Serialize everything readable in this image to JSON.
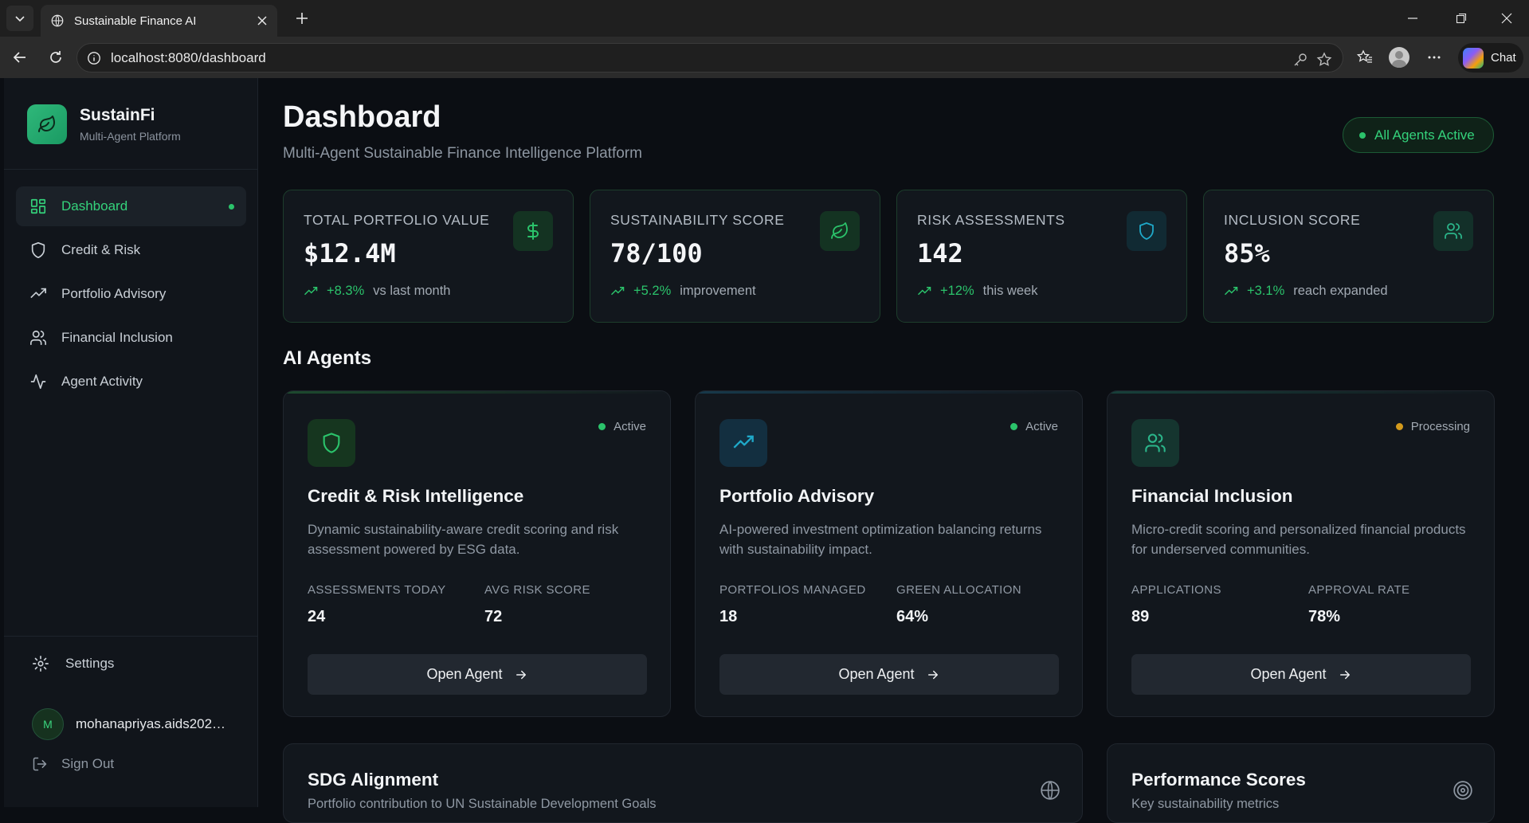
{
  "browser": {
    "tab_title": "Sustainable Finance AI",
    "url": "localhost:8080/dashboard",
    "chat_label": "Chat"
  },
  "sidebar": {
    "brand_name": "SustainFi",
    "brand_sub": "Multi-Agent Platform",
    "items": [
      {
        "label": "Dashboard",
        "icon": "layout-dashboard-icon",
        "active": true
      },
      {
        "label": "Credit & Risk",
        "icon": "shield-icon"
      },
      {
        "label": "Portfolio Advisory",
        "icon": "trending-up-icon"
      },
      {
        "label": "Financial Inclusion",
        "icon": "users-icon"
      },
      {
        "label": "Agent Activity",
        "icon": "activity-icon"
      }
    ],
    "settings_label": "Settings",
    "user_initial": "M",
    "user_name": "mohanapriyas.aids202…",
    "signout_label": "Sign Out"
  },
  "header": {
    "title": "Dashboard",
    "subtitle": "Multi-Agent Sustainable Finance Intelligence Platform",
    "status": "All Agents Active"
  },
  "stats": [
    {
      "label": "TOTAL PORTFOLIO VALUE",
      "value": "$12.4M",
      "change": "+8.3%",
      "note": "vs last month",
      "icon": "dollar-icon"
    },
    {
      "label": "SUSTAINABILITY SCORE",
      "value": "78/100",
      "change": "+5.2%",
      "note": "improvement",
      "icon": "leaf-icon"
    },
    {
      "label": "RISK ASSESSMENTS",
      "value": "142",
      "change": "+12%",
      "note": "this week",
      "icon": "shield-icon"
    },
    {
      "label": "INCLUSION SCORE",
      "value": "85%",
      "change": "+3.1%",
      "note": "reach expanded",
      "icon": "users-icon"
    }
  ],
  "agents_section_title": "AI Agents",
  "agents": [
    {
      "title": "Credit & Risk Intelligence",
      "status": "Active",
      "description": "Dynamic sustainability-aware credit scoring and risk assessment powered by ESG data.",
      "metrics": [
        {
          "label": "ASSESSMENTS TODAY",
          "value": "24"
        },
        {
          "label": "AVG RISK SCORE",
          "value": "72"
        }
      ],
      "button": "Open Agent"
    },
    {
      "title": "Portfolio Advisory",
      "status": "Active",
      "description": "AI-powered investment optimization balancing returns with sustainability impact.",
      "metrics": [
        {
          "label": "PORTFOLIOS MANAGED",
          "value": "18"
        },
        {
          "label": "GREEN ALLOCATION",
          "value": "64%"
        }
      ],
      "button": "Open Agent"
    },
    {
      "title": "Financial Inclusion",
      "status": "Processing",
      "description": "Micro-credit scoring and personalized financial products for underserved communities.",
      "metrics": [
        {
          "label": "APPLICATIONS",
          "value": "89"
        },
        {
          "label": "APPROVAL RATE",
          "value": "78%"
        }
      ],
      "button": "Open Agent"
    }
  ],
  "bottom": {
    "sdg_title": "SDG Alignment",
    "sdg_sub": "Portfolio contribution to UN Sustainable Development Goals",
    "perf_title": "Performance Scores",
    "perf_sub": "Key sustainability metrics"
  },
  "colors": {
    "accent_green": "#2bc36b",
    "active_status": "#2bc36b",
    "processing_status": "#d39a1c",
    "teal": "#1fa9c9"
  }
}
